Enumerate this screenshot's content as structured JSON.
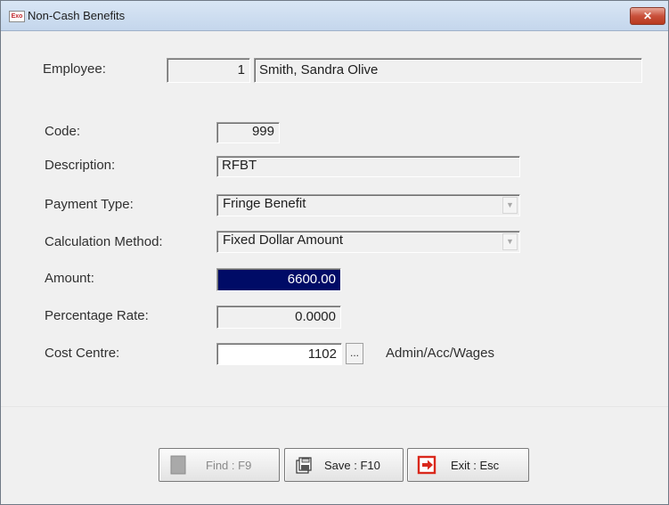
{
  "window": {
    "title": "Non-Cash Benefits",
    "icon_text": "Exo",
    "close_glyph": "✕"
  },
  "employee": {
    "label": "Employee:",
    "number": "1",
    "name": "Smith, Sandra Olive"
  },
  "form": {
    "code": {
      "label": "Code:",
      "value": "999"
    },
    "description": {
      "label": "Description:",
      "value": "RFBT"
    },
    "payment_type": {
      "label": "Payment Type:",
      "value": "Fringe Benefit"
    },
    "calc_method": {
      "label": "Calculation Method:",
      "value": "Fixed Dollar Amount"
    },
    "amount": {
      "label": "Amount:",
      "value": "6600.00"
    },
    "pct_rate": {
      "label": "Percentage Rate:",
      "value": "0.0000"
    },
    "cost_centre": {
      "label": "Cost Centre:",
      "value": "1102",
      "lookup": "...",
      "desc": "Admin/Acc/Wages"
    }
  },
  "buttons": {
    "find": "Find : F9",
    "save": "Save : F10",
    "exit": "Exit : Esc"
  },
  "colors": {
    "selection": "#000b66",
    "exit_icon": "#d9281c"
  },
  "arrow_glyph": "▼"
}
